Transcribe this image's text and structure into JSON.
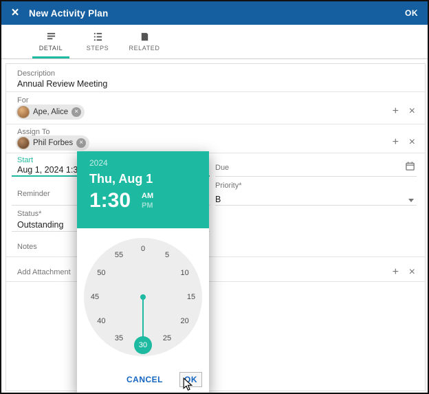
{
  "header": {
    "title": "New Activity Plan",
    "ok": "OK",
    "close_icon": "×"
  },
  "tabs": [
    {
      "label": "DETAIL"
    },
    {
      "label": "STEPS"
    },
    {
      "label": "RELATED"
    }
  ],
  "form": {
    "description": {
      "label": "Description",
      "value": "Annual Review Meeting"
    },
    "for_field": {
      "label": "For",
      "chip": "Ape, Alice"
    },
    "assign_to": {
      "label": "Assign To",
      "chip": "Phil Forbes"
    },
    "start": {
      "label": "Start",
      "value": "Aug 1, 2024 1:30 AM"
    },
    "due": {
      "label": "Due"
    },
    "priority": {
      "label": "Priority*",
      "value": "B"
    },
    "reminder": {
      "label": "Reminder"
    },
    "status": {
      "label": "Status*",
      "value": "Outstanding"
    },
    "notes": {
      "label": "Notes"
    },
    "attachment": {
      "label": "Add Attachment"
    },
    "add_icon": "+",
    "remove_icon": "×"
  },
  "time_picker": {
    "year": "2024",
    "date": "Thu, Aug 1",
    "time": "1:30",
    "am": "AM",
    "pm": "PM",
    "minutes": [
      "0",
      "5",
      "10",
      "15",
      "20",
      "25",
      "30",
      "35",
      "40",
      "45",
      "50",
      "55"
    ],
    "selected_minute": "30",
    "cancel": "CANCEL",
    "ok": "OK"
  },
  "colors": {
    "header_bg": "#155fa0",
    "accent": "#1db9a0",
    "button": "#1565c0"
  }
}
